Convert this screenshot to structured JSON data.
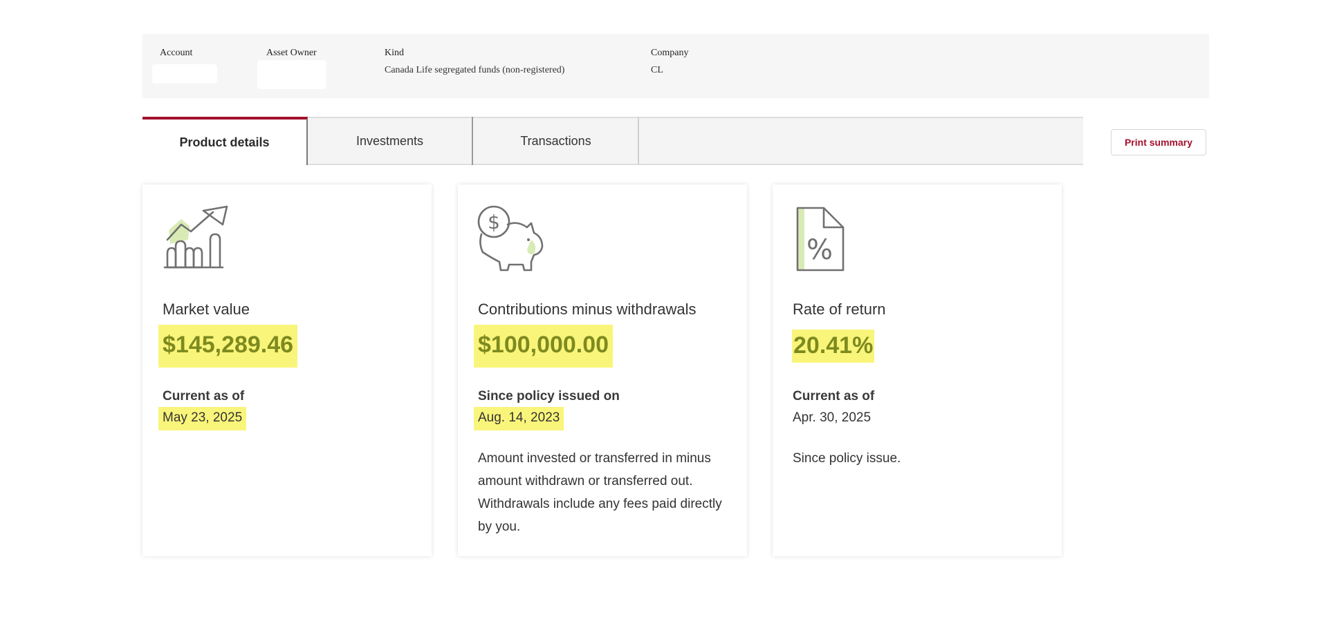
{
  "info_bar": {
    "account_label": "Account",
    "asset_owner_label": "Asset Owner",
    "kind_label": "Kind",
    "kind_value": "Canada Life segregated funds (non-registered)",
    "company_label": "Company",
    "company_value": "CL"
  },
  "tabs": [
    {
      "label": "Product details",
      "active": true
    },
    {
      "label": "Investments",
      "active": false
    },
    {
      "label": "Transactions",
      "active": false
    }
  ],
  "print_button": "Print summary",
  "cards": [
    {
      "icon": "growth-chart-icon",
      "title": "Market value",
      "value": "$145,289.46",
      "sublabel": "Current as of",
      "date": "May 23, 2025",
      "description": ""
    },
    {
      "icon": "piggy-bank-icon",
      "title": "Contributions minus withdrawals",
      "value": "$100,000.00",
      "sublabel": "Since policy issued on",
      "date": "Aug. 14, 2023",
      "description": "Amount invested or transferred in minus amount withdrawn or transferred out. Withdrawals include any fees paid directly by you."
    },
    {
      "icon": "percent-document-icon",
      "title": "Rate of return",
      "value": "20.41%",
      "sublabel": "Current as of",
      "date": "Apr. 30, 2025",
      "description": "Since policy issue."
    }
  ],
  "colors": {
    "accent": "#a3102c",
    "highlight": "#f9f57a",
    "icon_tint": "#d9ebb5"
  }
}
